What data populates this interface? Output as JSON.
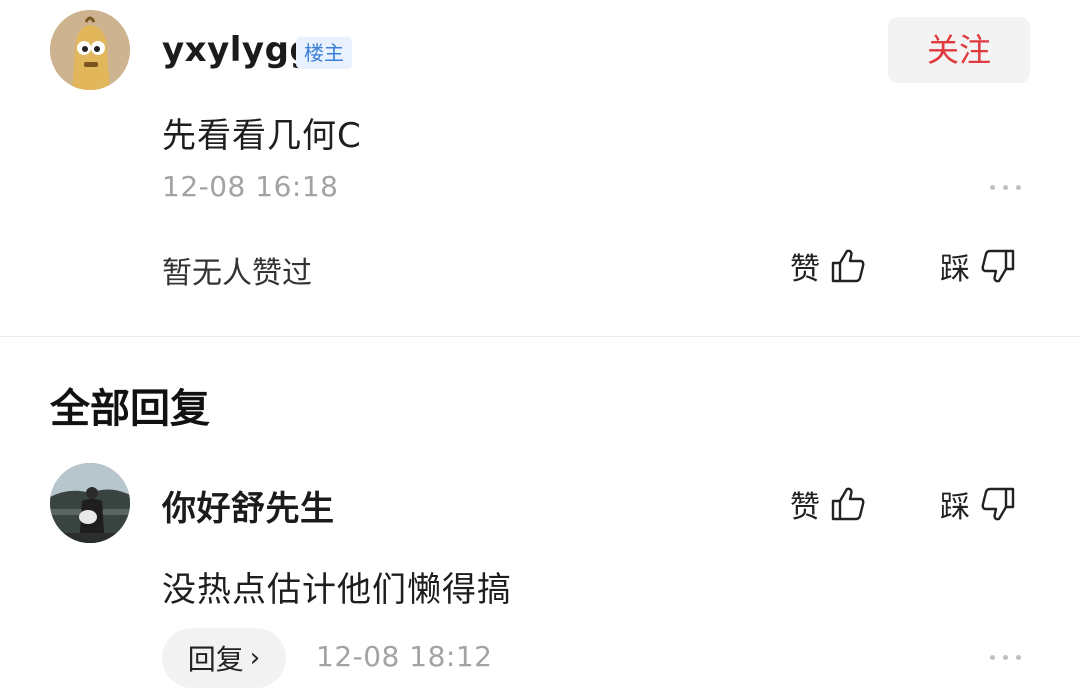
{
  "post": {
    "username": "yxylygg",
    "badge": "楼主",
    "follow_label": "关注",
    "content": "先看看几何C",
    "timestamp": "12-08 16:18",
    "likes_text": "暂无人赞过",
    "like_label": "赞",
    "dislike_label": "踩"
  },
  "replies_section": {
    "title": "全部回复"
  },
  "reply": {
    "username": "你好舒先生",
    "content": "没热点估计他们懒得搞",
    "reply_button_label": "回复",
    "timestamp": "12-08 18:12",
    "like_label": "赞",
    "dislike_label": "踩"
  },
  "colors": {
    "accent_red": "#e0393e",
    "badge_blue": "#3b7fd8",
    "muted_gray": "#a3a3a3"
  }
}
